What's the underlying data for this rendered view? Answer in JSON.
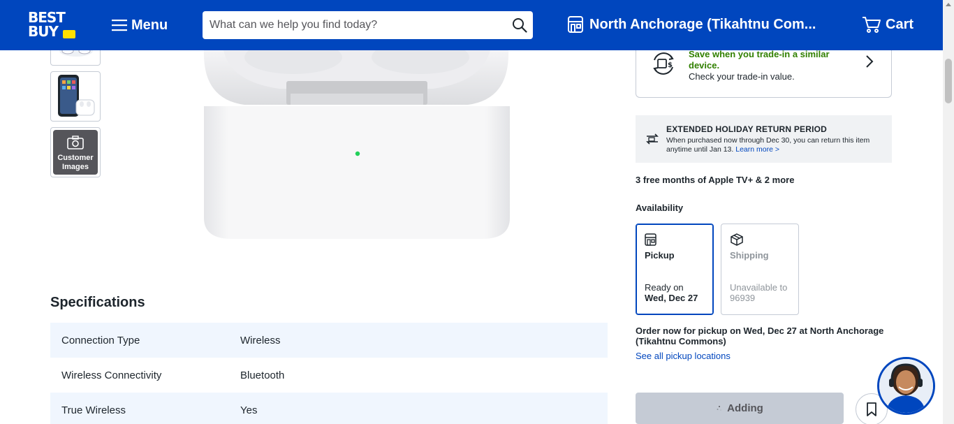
{
  "header": {
    "logo_line1": "BEST",
    "logo_line2": "BUY",
    "menu_label": "Menu",
    "search_placeholder": "What can we help you find today?",
    "store_label": "North Anchorage (Tikahtnu Com...",
    "cart_label": "Cart",
    "brand_color": "#0046be",
    "tag_color": "#ffe000"
  },
  "gallery": {
    "customer_images_label_1": "Customer",
    "customer_images_label_2": "Images"
  },
  "specifications": {
    "title": "Specifications",
    "rows": [
      {
        "key": "Connection Type",
        "value": "Wireless"
      },
      {
        "key": "Wireless Connectivity",
        "value": "Bluetooth"
      },
      {
        "key": "True Wireless",
        "value": "Yes"
      }
    ]
  },
  "trade_in": {
    "headline_1": "Save when you trade-in a similar",
    "headline_2": "device.",
    "subtext": "Check your trade-in value."
  },
  "holiday": {
    "title": "EXTENDED HOLIDAY RETURN PERIOD",
    "body": "When purchased now through Dec 30, you can return this item anytime until Jan 13.",
    "link": "Learn more >"
  },
  "promo": {
    "apple_tv": "3 free months of Apple TV+ & 2 more"
  },
  "availability": {
    "title": "Availability",
    "pickup": {
      "name": "Pickup",
      "line1": "Ready on",
      "line2": "Wed, Dec 27"
    },
    "shipping": {
      "name": "Shipping",
      "line1": "Unavailable to",
      "line2": "96939"
    },
    "order_note": "Order now for pickup on Wed, Dec 27 at North Anchorage (Tikahtnu Commons)",
    "see_all": "See all pickup locations"
  },
  "actions": {
    "add_label": "Adding"
  }
}
